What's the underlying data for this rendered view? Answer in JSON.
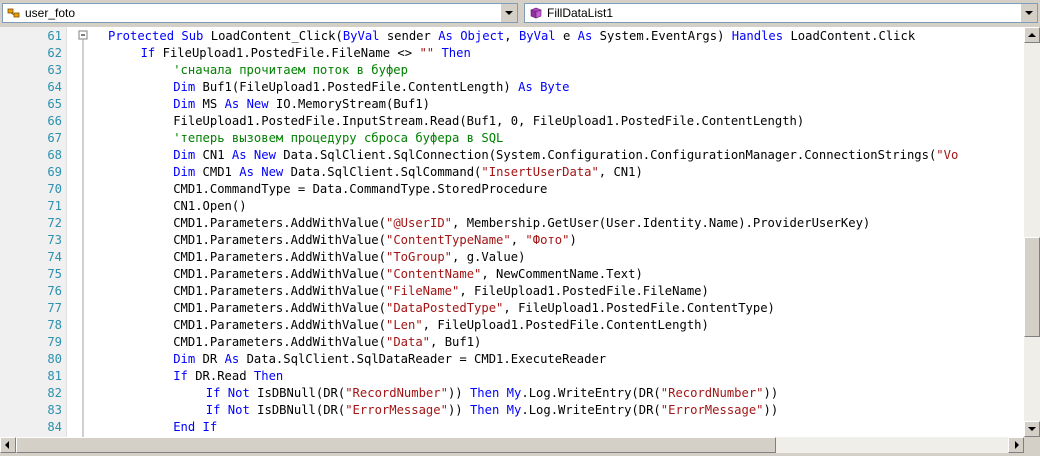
{
  "left_dropdown": {
    "label": "user_foto",
    "icon": "class-icon"
  },
  "right_dropdown": {
    "label": "FillDataList1",
    "icon": "method-icon"
  },
  "colors": {
    "keyword": "#0000ff",
    "string": "#a31515",
    "comment": "#008000",
    "line_number": "#2b91af"
  },
  "lines": [
    {
      "num": "61",
      "indent": 0,
      "tokens": [
        [
          "kw",
          "Protected Sub"
        ],
        [
          "t",
          " LoadContent_Click("
        ],
        [
          "kw",
          "ByVal"
        ],
        [
          "t",
          " sender "
        ],
        [
          "kw",
          "As Object"
        ],
        [
          "t",
          ", "
        ],
        [
          "kw",
          "ByVal"
        ],
        [
          "t",
          " e "
        ],
        [
          "kw",
          "As"
        ],
        [
          "t",
          " System.EventArgs) "
        ],
        [
          "kw",
          "Handles"
        ],
        [
          "t",
          " LoadContent.Click"
        ]
      ]
    },
    {
      "num": "62",
      "indent": 1,
      "tokens": [
        [
          "kw",
          "If"
        ],
        [
          "t",
          " FileUpload1.PostedFile.FileName <> "
        ],
        [
          "str",
          "\"\""
        ],
        [
          "t",
          " "
        ],
        [
          "kw",
          "Then"
        ]
      ]
    },
    {
      "num": "63",
      "indent": 2,
      "tokens": [
        [
          "cm",
          "'сначала прочитаем поток в буфер"
        ]
      ]
    },
    {
      "num": "64",
      "indent": 2,
      "tokens": [
        [
          "kw",
          "Dim"
        ],
        [
          "t",
          " Buf1(FileUpload1.PostedFile.ContentLength) "
        ],
        [
          "kw",
          "As Byte"
        ]
      ]
    },
    {
      "num": "65",
      "indent": 2,
      "tokens": [
        [
          "kw",
          "Dim"
        ],
        [
          "t",
          " MS "
        ],
        [
          "kw",
          "As New"
        ],
        [
          "t",
          " IO.MemoryStream(Buf1)"
        ]
      ]
    },
    {
      "num": "66",
      "indent": 2,
      "tokens": [
        [
          "t",
          "FileUpload1.PostedFile.InputStream.Read(Buf1, 0, FileUpload1.PostedFile.ContentLength)"
        ]
      ]
    },
    {
      "num": "67",
      "indent": 2,
      "tokens": [
        [
          "cm",
          "'теперь вызовем процедуру сброса буфера в SQL"
        ]
      ]
    },
    {
      "num": "68",
      "indent": 2,
      "tokens": [
        [
          "kw",
          "Dim"
        ],
        [
          "t",
          " CN1 "
        ],
        [
          "kw",
          "As New"
        ],
        [
          "t",
          " Data.SqlClient.SqlConnection(System.Configuration.ConfigurationManager.ConnectionStrings("
        ],
        [
          "str",
          "\"Vo"
        ]
      ]
    },
    {
      "num": "69",
      "indent": 2,
      "tokens": [
        [
          "kw",
          "Dim"
        ],
        [
          "t",
          " CMD1 "
        ],
        [
          "kw",
          "As New"
        ],
        [
          "t",
          " Data.SqlClient.SqlCommand("
        ],
        [
          "str",
          "\"InsertUserData\""
        ],
        [
          "t",
          ", CN1)"
        ]
      ]
    },
    {
      "num": "70",
      "indent": 2,
      "tokens": [
        [
          "t",
          "CMD1.CommandType = Data.CommandType.StoredProcedure"
        ]
      ]
    },
    {
      "num": "71",
      "indent": 2,
      "tokens": [
        [
          "t",
          "CN1.Open()"
        ]
      ]
    },
    {
      "num": "72",
      "indent": 2,
      "tokens": [
        [
          "t",
          "CMD1.Parameters.AddWithValue("
        ],
        [
          "str",
          "\"@UserID\""
        ],
        [
          "t",
          ", Membership.GetUser(User.Identity.Name).ProviderUserKey)"
        ]
      ]
    },
    {
      "num": "73",
      "indent": 2,
      "tokens": [
        [
          "t",
          "CMD1.Parameters.AddWithValue("
        ],
        [
          "str",
          "\"ContentTypeName\""
        ],
        [
          "t",
          ", "
        ],
        [
          "str",
          "\"Фото\""
        ],
        [
          "t",
          ")"
        ]
      ]
    },
    {
      "num": "74",
      "indent": 2,
      "tokens": [
        [
          "t",
          "CMD1.Parameters.AddWithValue("
        ],
        [
          "str",
          "\"ToGroup\""
        ],
        [
          "t",
          ", g.Value)"
        ]
      ]
    },
    {
      "num": "75",
      "indent": 2,
      "tokens": [
        [
          "t",
          "CMD1.Parameters.AddWithValue("
        ],
        [
          "str",
          "\"ContentName\""
        ],
        [
          "t",
          ", NewCommentName.Text)"
        ]
      ]
    },
    {
      "num": "76",
      "indent": 2,
      "tokens": [
        [
          "t",
          "CMD1.Parameters.AddWithValue("
        ],
        [
          "str",
          "\"FileName\""
        ],
        [
          "t",
          ", FileUpload1.PostedFile.FileName)"
        ]
      ]
    },
    {
      "num": "77",
      "indent": 2,
      "tokens": [
        [
          "t",
          "CMD1.Parameters.AddWithValue("
        ],
        [
          "str",
          "\"DataPostedType\""
        ],
        [
          "t",
          ", FileUpload1.PostedFile.ContentType)"
        ]
      ]
    },
    {
      "num": "78",
      "indent": 2,
      "tokens": [
        [
          "t",
          "CMD1.Parameters.AddWithValue("
        ],
        [
          "str",
          "\"Len\""
        ],
        [
          "t",
          ", FileUpload1.PostedFile.ContentLength)"
        ]
      ]
    },
    {
      "num": "79",
      "indent": 2,
      "tokens": [
        [
          "t",
          "CMD1.Parameters.AddWithValue("
        ],
        [
          "str",
          "\"Data\""
        ],
        [
          "t",
          ", Buf1)"
        ]
      ]
    },
    {
      "num": "80",
      "indent": 2,
      "tokens": [
        [
          "kw",
          "Dim"
        ],
        [
          "t",
          " DR "
        ],
        [
          "kw",
          "As"
        ],
        [
          "t",
          " Data.SqlClient.SqlDataReader = CMD1.ExecuteReader"
        ]
      ]
    },
    {
      "num": "81",
      "indent": 2,
      "tokens": [
        [
          "kw",
          "If"
        ],
        [
          "t",
          " DR.Read "
        ],
        [
          "kw",
          "Then"
        ]
      ]
    },
    {
      "num": "82",
      "indent": 3,
      "tokens": [
        [
          "kw",
          "If Not"
        ],
        [
          "t",
          " IsDBNull(DR("
        ],
        [
          "str",
          "\"RecordNumber\""
        ],
        [
          "t",
          ")) "
        ],
        [
          "kw",
          "Then"
        ],
        [
          "t",
          " "
        ],
        [
          "kw",
          "My"
        ],
        [
          "t",
          ".Log.WriteEntry(DR("
        ],
        [
          "str",
          "\"RecordNumber\""
        ],
        [
          "t",
          "))"
        ]
      ]
    },
    {
      "num": "83",
      "indent": 3,
      "tokens": [
        [
          "kw",
          "If Not"
        ],
        [
          "t",
          " IsDBNull(DR("
        ],
        [
          "str",
          "\"ErrorMessage\""
        ],
        [
          "t",
          ")) "
        ],
        [
          "kw",
          "Then"
        ],
        [
          "t",
          " "
        ],
        [
          "kw",
          "My"
        ],
        [
          "t",
          ".Log.WriteEntry(DR("
        ],
        [
          "str",
          "\"ErrorMessage\""
        ],
        [
          "t",
          "))"
        ]
      ]
    },
    {
      "num": "84",
      "indent": 2,
      "tokens": [
        [
          "kw",
          "End If"
        ]
      ]
    }
  ]
}
